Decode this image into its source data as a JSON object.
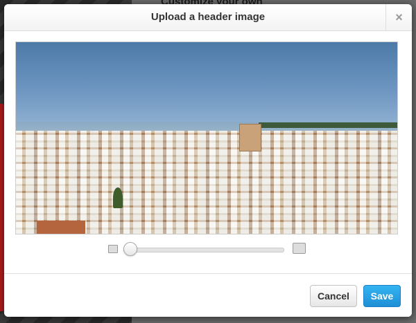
{
  "background": {
    "heading": "Customize your own"
  },
  "modal": {
    "title": "Upload a header image",
    "close_glyph": "×",
    "zoom": {
      "level": 0
    },
    "footer": {
      "cancel_label": "Cancel",
      "save_label": "Save"
    }
  },
  "colors": {
    "save_button": "#2aa3e6",
    "cancel_button": "#f2f2f2"
  }
}
